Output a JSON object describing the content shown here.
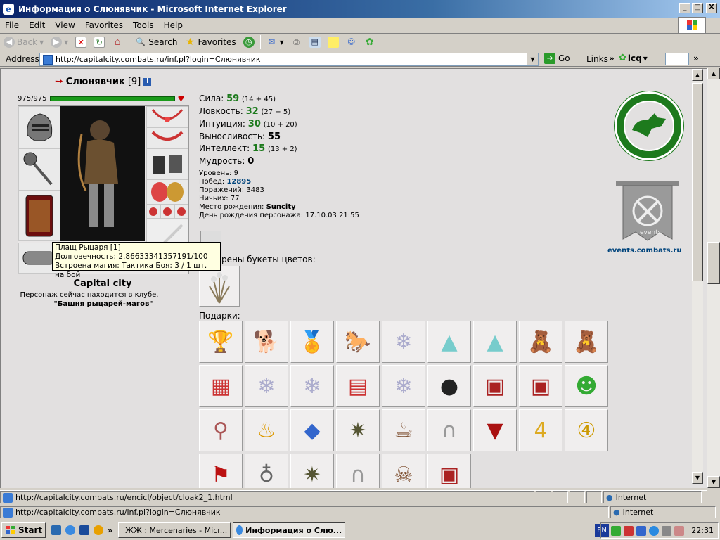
{
  "window": {
    "title": "Информация о Слюнявчик - Microsoft Internet Explorer",
    "min": "_",
    "max": "□",
    "close": "X"
  },
  "menu": [
    "File",
    "Edit",
    "View",
    "Favorites",
    "Tools",
    "Help"
  ],
  "toolbar": {
    "back": "Back",
    "search": "Search",
    "favorites": "Favorites"
  },
  "address": {
    "label": "Address",
    "url": "http://capitalcity.combats.ru/inf.pl?login=Слюнявчик",
    "go": "Go",
    "links": "Links",
    "icq": "icq"
  },
  "character": {
    "name": "Слюнявчик",
    "level": "[9]",
    "hp": "975/975",
    "city": "Capital city",
    "club_line": "Персонаж сейчас находится в клубе.",
    "club_name": "\"Башня рыцарей-магов\""
  },
  "tooltip": {
    "line1": "Плащ Рыцаря [1]",
    "line2": "Долговечность: 2.86633341357191/100",
    "line3": "Встроена магия: Тактика Боя: 3 / 1 шт. на бой"
  },
  "stats": [
    {
      "label": "Сила:",
      "value": "59",
      "extra": "(14 + 45)"
    },
    {
      "label": "Ловкость:",
      "value": "32",
      "extra": "(27 + 5)"
    },
    {
      "label": "Интуиция:",
      "value": "30",
      "extra": "(10 + 20)"
    },
    {
      "label": "Выносливость:",
      "value": "55",
      "extra": ""
    },
    {
      "label": "Интеллект:",
      "value": "15",
      "extra": "(13 + 2)"
    },
    {
      "label": "Мудрость:",
      "value": "0",
      "extra": ""
    }
  ],
  "info": {
    "level": "Уровень: 9",
    "wins_label": "Побед:",
    "wins": "12895",
    "losses": "Поражений: 3483",
    "draws": "Ничьих: 77",
    "birthplace_label": "Место рождения:",
    "birthplace": "Suncity",
    "birthday": "День рождения персонажа: 17.10.03 21:55"
  },
  "bouquets_title": "Подарены букеты цветов:",
  "gifts_title": "Подарки:",
  "events_link": "events.combats.ru",
  "events_badge": "events",
  "status": {
    "link": "http://capitalcity.combats.ru/encicl/object/cloak2_1.html",
    "zone": "Internet"
  },
  "status2": {
    "link": "http://capitalcity.combats.ru/inf.pl?login=Слюнявчик",
    "zone": "Internet"
  },
  "taskbar": {
    "start": "Start",
    "tasks": [
      "ЖЖ : Mercenaries - Micr...",
      "Информация о Слю..."
    ],
    "lang": "EN",
    "clock": "22:31"
  },
  "colors": {
    "stat_green": "#1d7a1d",
    "link_blue": "#00447c"
  }
}
